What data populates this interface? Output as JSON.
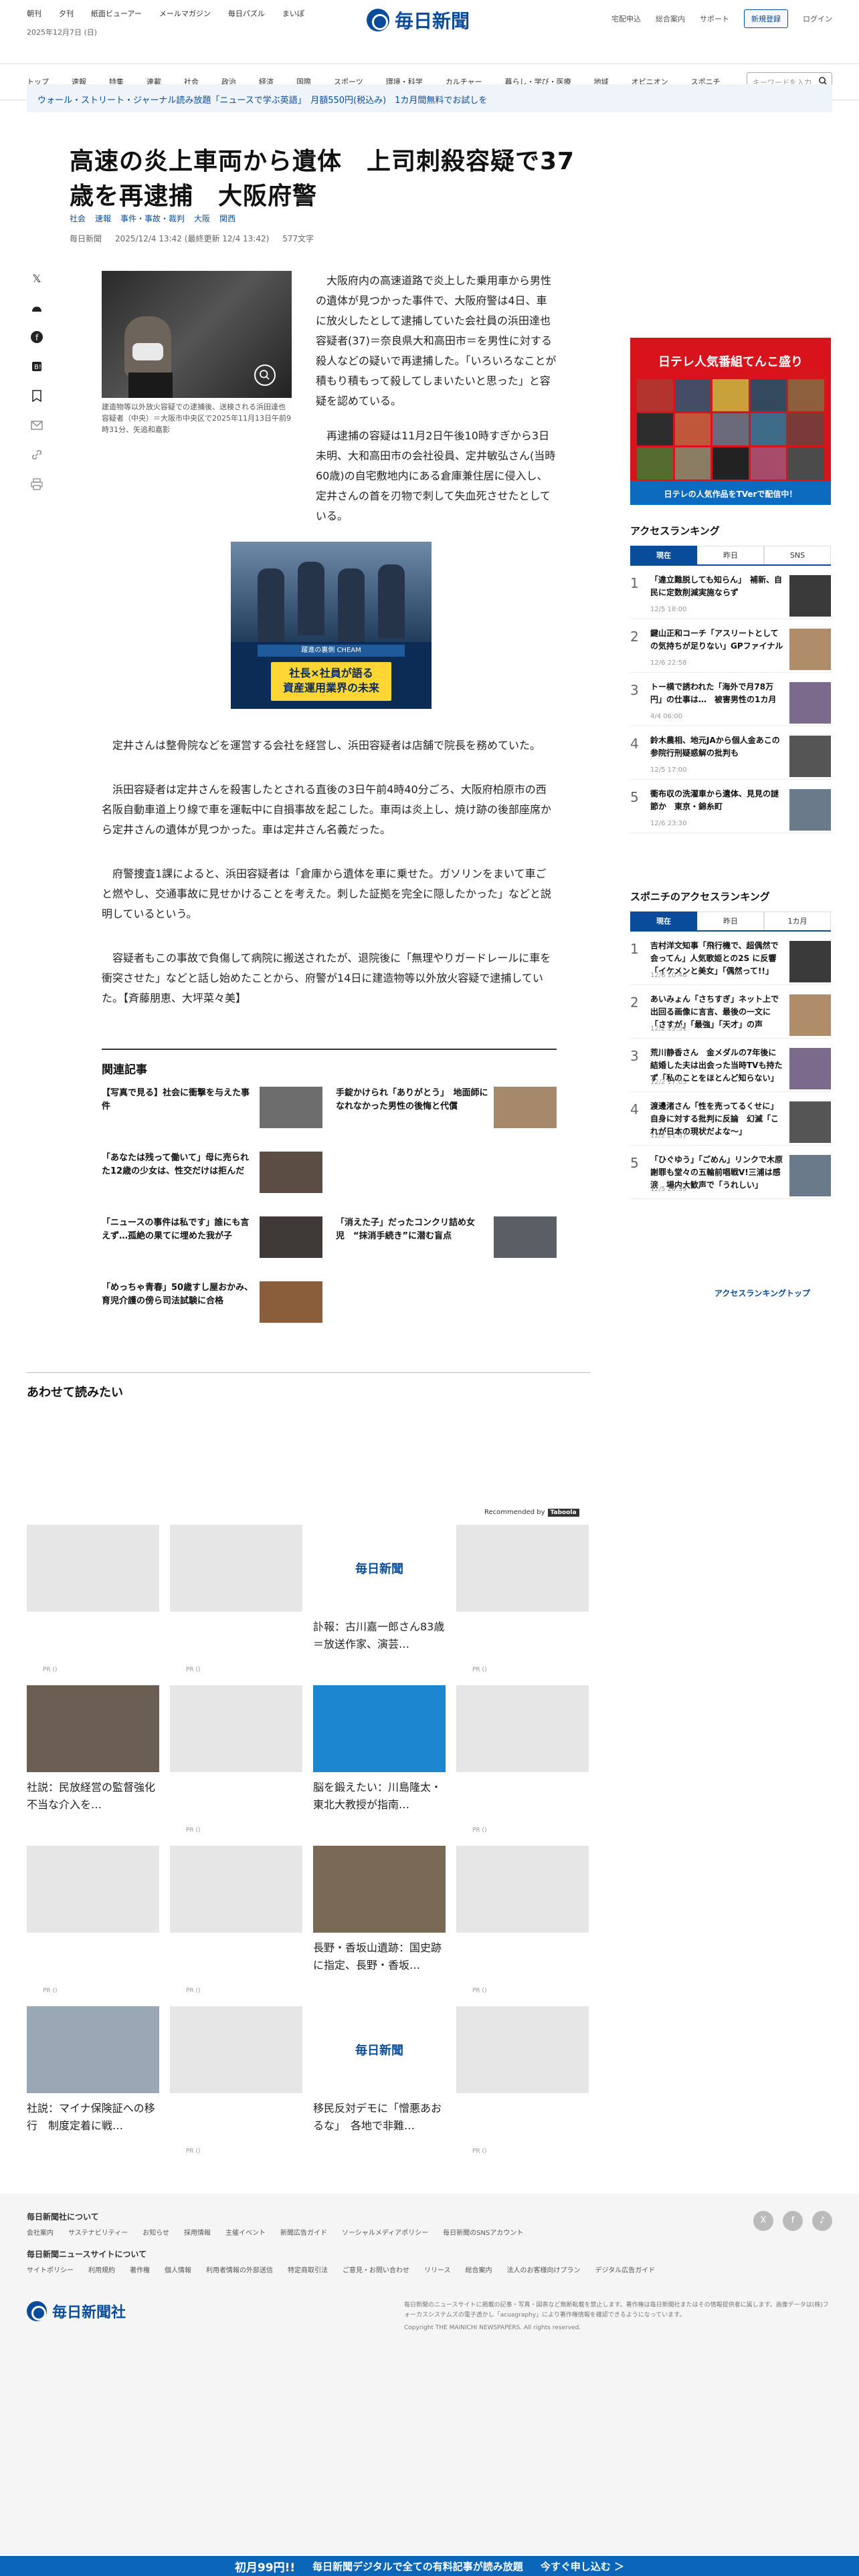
{
  "header": {
    "topnav": [
      "朝刊",
      "夕刊",
      "紙面ビューアー",
      "メールマガジン",
      "毎日パズル",
      "まいぽ"
    ],
    "date": "2025年12月7日 (日)",
    "logo": "毎日新聞",
    "utility": [
      "宅配申込",
      "総合案内",
      "サポート"
    ],
    "register": "新規登録",
    "login": "ログイン"
  },
  "nav": {
    "items": [
      "トップ",
      "速報",
      "特集",
      "連載",
      "社会",
      "政治",
      "経済",
      "国際",
      "スポーツ",
      "環境・科学",
      "カルチャー",
      "暮らし・学び・医療",
      "地域",
      "オピニオン",
      "スポニチ"
    ],
    "search_placeholder": "キーワードを入力"
  },
  "promo": "ウォール・ストリート・ジャーナル読み放題「ニュースで学ぶ英語」　月額550円(税込み)　1カ月間無料でお試しを",
  "article": {
    "title": "高速の炎上車両から遺体　上司刺殺容疑で37歳を再逮捕　大阪府警",
    "tags": [
      "社会",
      "速報",
      "事件・事故・裁判",
      "大阪",
      "関西"
    ],
    "meta": [
      "毎日新聞",
      "2025/12/4 13:42 (最終更新 12/4 13:42)",
      "577文字"
    ],
    "share_count": "",
    "photo_caption": "建造物等以外放火容疑での逮捕後、送検される浜田達也容疑者（中央）＝大阪市中央区で2025年11月13日午前9時31分、矢追和嘉影",
    "p1": "大阪府内の高速道路で炎上した乗用車から男性の遺体が見つかった事件で、大阪府警は4日、車に放火したとして逮捕していた会社員の浜田達也容疑者(37)＝奈良県大和高田市＝を男性に対する殺人などの疑いで再逮捕した。「いろいろなことが積もり積もって殺してしまいたいと思った」と容疑を認めている。",
    "p2": "再逮捕の容疑は11月2日午後10時すぎから3日未明、大和高田市の会社役員、定井敏弘さん(当時60歳)の自宅敷地内にある倉庫兼住居に侵入し、定井さんの首を刃物で刺して失血死させたとしている。",
    "ad_band": "躍進の裏側 CHEAM",
    "ad_text": "社長×社員が語る\n資産運用業界の未来",
    "p3": "定井さんは整骨院などを運営する会社を経営し、浜田容疑者は店舗で院長を務めていた。",
    "p4": "浜田容疑者は定井さんを殺害したとされる直後の3日午前4時40分ごろ、大阪府柏原市の西名阪自動車道上り線で車を運転中に自損事故を起こした。車両は炎上し、焼け跡の後部座席から定井さんの遺体が見つかった。車は定井さん名義だった。",
    "p5": "府警捜査1課によると、浜田容疑者は「倉庫から遺体を車に乗せた。ガソリンをまいて車ごと燃やし、交通事故に見せかけることを考えた。刺した証拠を完全に隠したかった」などと説明しているという。",
    "p6": "容疑者もこの事故で負傷して病院に搬送されたが、退院後に「無理やりガードレールに車を衝突させた」などと話し始めたことから、府警が14日に建造物等以外放火容疑で逮捕していた。【斉藤朋恵、大坪菜々美】"
  },
  "related": {
    "title": "関連記事",
    "items": [
      "【写真で見る】社会に衝撃を与えた事件",
      "手錠かけられ「ありがとう」　地面師になれなかった男性の後悔と代償",
      "「あなたは残って働いて」母に売られた12歳の少女は、性交だけは拒んだ",
      "「ニュースの事件は私です」誰にも言えず…孤絶の果てに埋めた我が子",
      "「消えた子」だったコンクリ詰め女児　“抹消手続き”に潜む盲点",
      "「めっちゃ青春」50歳すし屋おかみ、育児介護の傍ら司法試験に合格"
    ]
  },
  "awasete": {
    "title": "あわせて読みたい",
    "recommended": "Recommended by",
    "taboola": "Taboola",
    "pr": "PR ()",
    "cards": [
      "",
      "",
      "訃報：古川嘉一郎さん83歳＝放送作家、演芸…",
      "",
      "社説：民放経営の監督強化　不当な介入を…",
      "",
      "脳を鍛えたい：川島隆太・東北大教授が指南…",
      "",
      "",
      "",
      "長野・香坂山遺跡：国史跡に指定、長野・香坂…",
      "",
      "社説：マイナ保険証への移行　制度定着に戦…",
      "",
      "移民反対デモに「憎悪あおるな」　各地で非難…",
      ""
    ]
  },
  "sidebar": {
    "ad_top": "日テレ人気番組てんこ盛り",
    "ad_bottom": "日テレの人気作品をTVerで配信中！",
    "ranking1": {
      "title": "アクセスランキング",
      "tabs": [
        "現在",
        "昨日",
        "SNS"
      ],
      "items": [
        {
          "n": "1",
          "t": "「違立難脱しても知らん」　補新、自民に定数削減実施ならず",
          "tm": "12/5 18:00"
        },
        {
          "n": "2",
          "t": "鍵山正和コーチ「アスリートとしての気持ちが足りない」GPファイナル",
          "tm": "12/6 22:58"
        },
        {
          "n": "3",
          "t": "トー横で誘われた「海外で月78万円」の仕事は…　被害男性の1カ月",
          "tm": "4/4 06:00"
        },
        {
          "n": "4",
          "t": "鈴木農相、地元JAから個人金あこの参院行刑疑惑解の批判も",
          "tm": "12/5 17:00"
        },
        {
          "n": "5",
          "t": "衝布収の洗濯車から遺体、見見の謎節か　東京・錦糸町",
          "tm": "12/6 23:30"
        }
      ]
    },
    "ranking2": {
      "title": "スポニチのアクセスランキング",
      "tabs": [
        "現在",
        "昨日",
        "1カ月"
      ],
      "items": [
        {
          "n": "1",
          "t": "吉村洋文知事「飛行機で、超偶然で会ってん」人気歌姫との2S に反響「イケメンと美女」「偶然って!!」",
          "tm": "12/6 10:46"
        },
        {
          "n": "2",
          "t": "あいみょん「さちすぎ」ネット上で出回る画像に言言、最後の一文に「さすが」「最強」「天才」の声",
          "tm": "12/2 19:51"
        },
        {
          "n": "3",
          "t": "荒川静香さん　金メダルの7年後に結婚した夫は出会った当時TVも持たず「私のことをほとんど知らない」",
          "tm": "12/2 17:05"
        },
        {
          "n": "4",
          "t": "渡邊渚さん「性を売ってるくせに」自身に対する批判に反論　幻滅「これが日本の現状だよな～」",
          "tm": "12/2 21:37"
        },
        {
          "n": "5",
          "t": "「ひぐゆう」「ごめん」リンクで木原謝罪も堂々の五輪前唱戦V!三浦は感涙　場内大歓声で「うれしい」",
          "tm": "12/5 20:39"
        }
      ]
    },
    "ranking_link": "アクセスランキングトップ"
  },
  "footer": {
    "h1": "毎日新聞社について",
    "links1": [
      "会社案内",
      "サステナビリティー",
      "お知らせ",
      "採用情報",
      "主催イベント",
      "新聞広告ガイド",
      "ソーシャルメディアポリシー",
      "毎日新聞のSNSアカウント"
    ],
    "h2": "毎日新聞ニュースサイトについて",
    "links2": [
      "サイトポリシー",
      "利用規約",
      "著作権",
      "個人情報",
      "利用者情報の外部送信",
      "特定商取引法",
      "ご意見・お問い合わせ",
      "リリース",
      "総合案内",
      "法人のお客様向けプラン",
      "デジタル広告ガイド"
    ],
    "sns": [
      "X",
      "f",
      "♪"
    ],
    "logo": "毎日新聞社",
    "note": "毎日新聞のニュースサイトに掲載の記事・写真・図表など無断転載を禁止します。著作権は毎日新聞社またはその情報提供者に属します。画像データは(株)フォーカスシステムズの電子透かし「acuagraphy」により著作権情報を確認できるようになっています。",
    "copyright": "Copyright THE MAINICHI NEWSPAPERS. All rights reserved."
  },
  "bottom": {
    "price": "初月99円!!",
    "text": "毎日新聞デジタルで全ての有料記事が読み放題",
    "cta": "今すぐ申し込む ＞"
  }
}
